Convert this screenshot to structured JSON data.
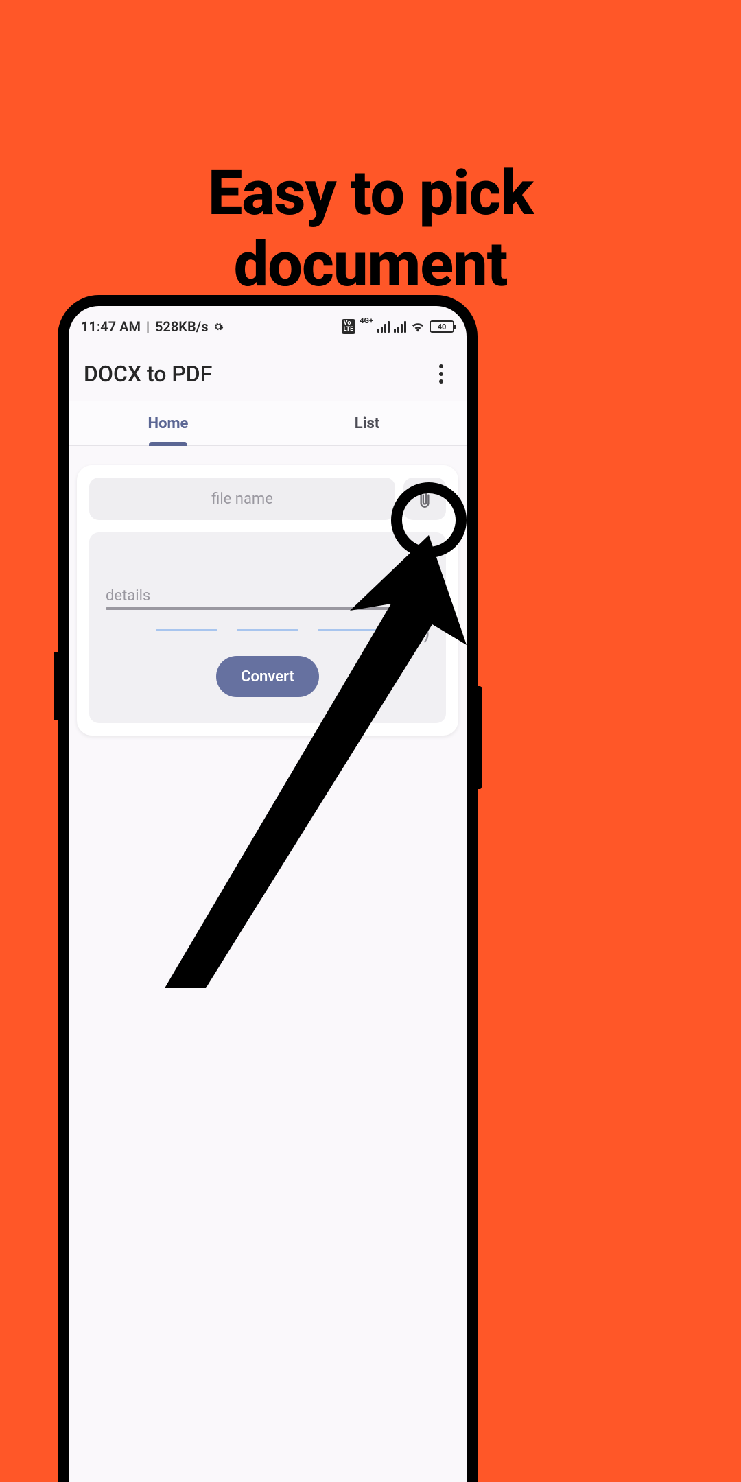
{
  "promo": {
    "headline_line1": "Easy to pick",
    "headline_line2": "document"
  },
  "status_bar": {
    "time": "11:47 AM",
    "net_speed": "528KB/s",
    "network_label": "4G+",
    "battery_level": "40"
  },
  "app_bar": {
    "title": "DOCX to PDF"
  },
  "tabs": {
    "home": "Home",
    "list": "List"
  },
  "card": {
    "filename_placeholder": "file name",
    "details_label": "details",
    "progress_counter": "(0/3)",
    "convert_label": "Convert"
  }
}
